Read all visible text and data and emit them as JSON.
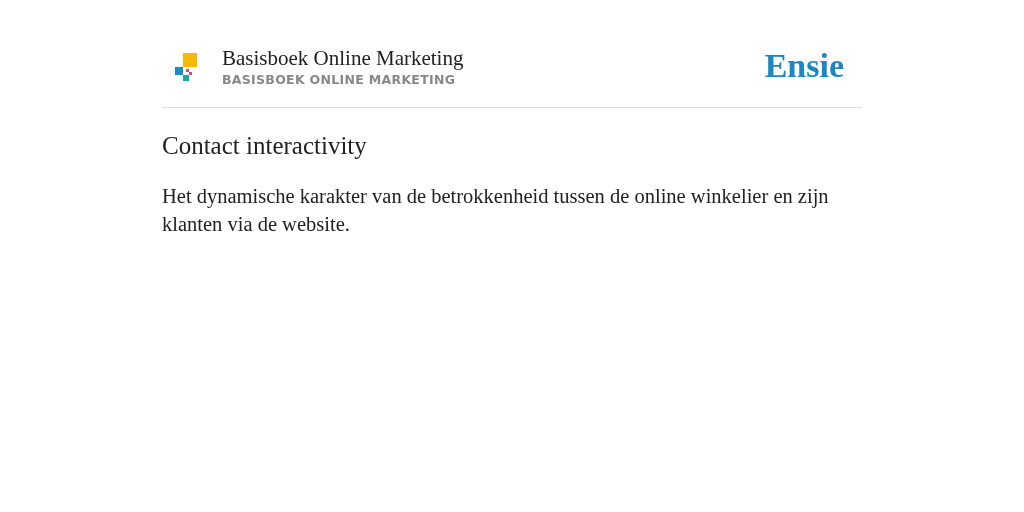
{
  "header": {
    "title": "Basisboek Online Marketing",
    "subtitle": "BASISBOEK ONLINE MARKETING",
    "brand": "Ensie"
  },
  "entry": {
    "term": "Contact interactivity",
    "definition": "Het dynamische karakter van de betrokkenheid tussen de online winkelier en zijn klanten via de website."
  }
}
